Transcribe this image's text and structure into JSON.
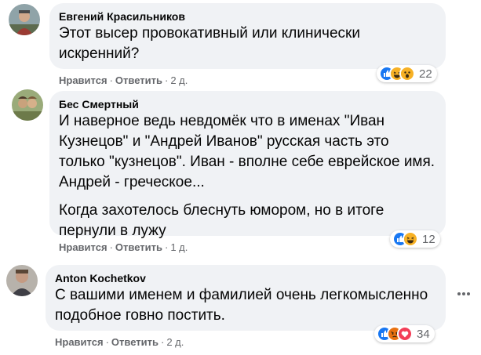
{
  "comments": [
    {
      "author": "Евгений Красильников",
      "paragraphs": [
        "Этот высер провокативный или клинически искренний?"
      ],
      "like_label": "Нравится",
      "reply_label": "Ответить",
      "time": "2 д.",
      "reactions": [
        "like",
        "haha",
        "wow"
      ],
      "reaction_count": "22"
    },
    {
      "author": "Бес Смертный",
      "paragraphs": [
        "И наверное ведь невдомёк что в именах \"Иван Кузнецов\" и \"Андрей Иванов\" русская часть это только \"кузнецов\". Иван - вполне себе еврейское имя. Андрей - греческое...",
        "Когда захотелось блеснуть юмором, но в итоге пернули в лужу"
      ],
      "like_label": "Нравится",
      "reply_label": "Ответить",
      "time": "1 д.",
      "reactions": [
        "like",
        "haha"
      ],
      "reaction_count": "12"
    },
    {
      "author": "Anton Kochetkov",
      "paragraphs": [
        "С вашими именем и фамилией очень легкомысленно подобное говно постить."
      ],
      "like_label": "Нравится",
      "reply_label": "Ответить",
      "time": "2 д.",
      "reactions": [
        "like",
        "angry",
        "love"
      ],
      "reaction_count": "34"
    }
  ],
  "separator": "·",
  "colors": {
    "like": "#1877f2",
    "haha": "#f7b125",
    "wow": "#f7b125",
    "angry": "#e9710f",
    "love": "#f33e58",
    "bubble": "#f0f2f5",
    "meta": "#65676b"
  }
}
